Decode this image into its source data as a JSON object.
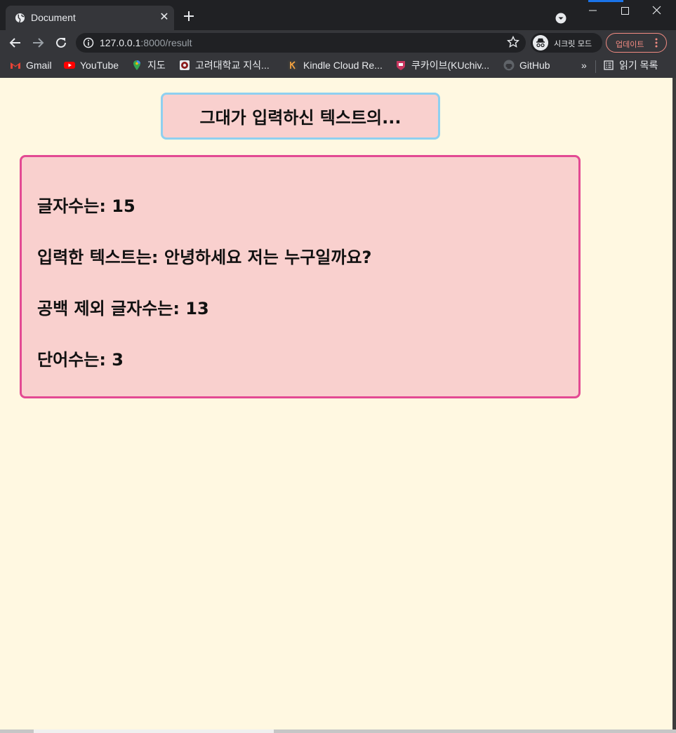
{
  "browser": {
    "tab": {
      "title": "Document",
      "close": "✕"
    },
    "new_tab": "+",
    "url": {
      "host": "127.0.0.1",
      "rest": ":8000/result"
    },
    "incognito_label": "시크릿 모드",
    "update_label": "업데이트",
    "bookmarks": [
      {
        "label": "Gmail",
        "icon": "gmail-icon"
      },
      {
        "label": "YouTube",
        "icon": "youtube-icon"
      },
      {
        "label": "지도",
        "icon": "maps-icon"
      },
      {
        "label": "고려대학교 지식...",
        "icon": "korea-univ-icon"
      },
      {
        "label": "Kindle Cloud Re...",
        "icon": "kindle-icon"
      },
      {
        "label": "쿠카이브(KUchiv...",
        "icon": "kuchive-icon"
      },
      {
        "label": "GitHub",
        "icon": "github-icon"
      }
    ],
    "more_bookmarks": "»",
    "reading_list": "읽기 목록"
  },
  "page": {
    "title": "그대가 입력하신 텍스트의...",
    "lines": [
      "글자수는: 15",
      "입력한 텍스트는: 안녕하세요 저는 누구일까요?",
      "공백 제외 글자수는: 13",
      "단어수는: 3"
    ]
  },
  "colors": {
    "page_bg": "#fff8e1",
    "box_bg": "#f9d0ce",
    "title_border": "#8fd0f0",
    "result_border": "#e34a93"
  }
}
